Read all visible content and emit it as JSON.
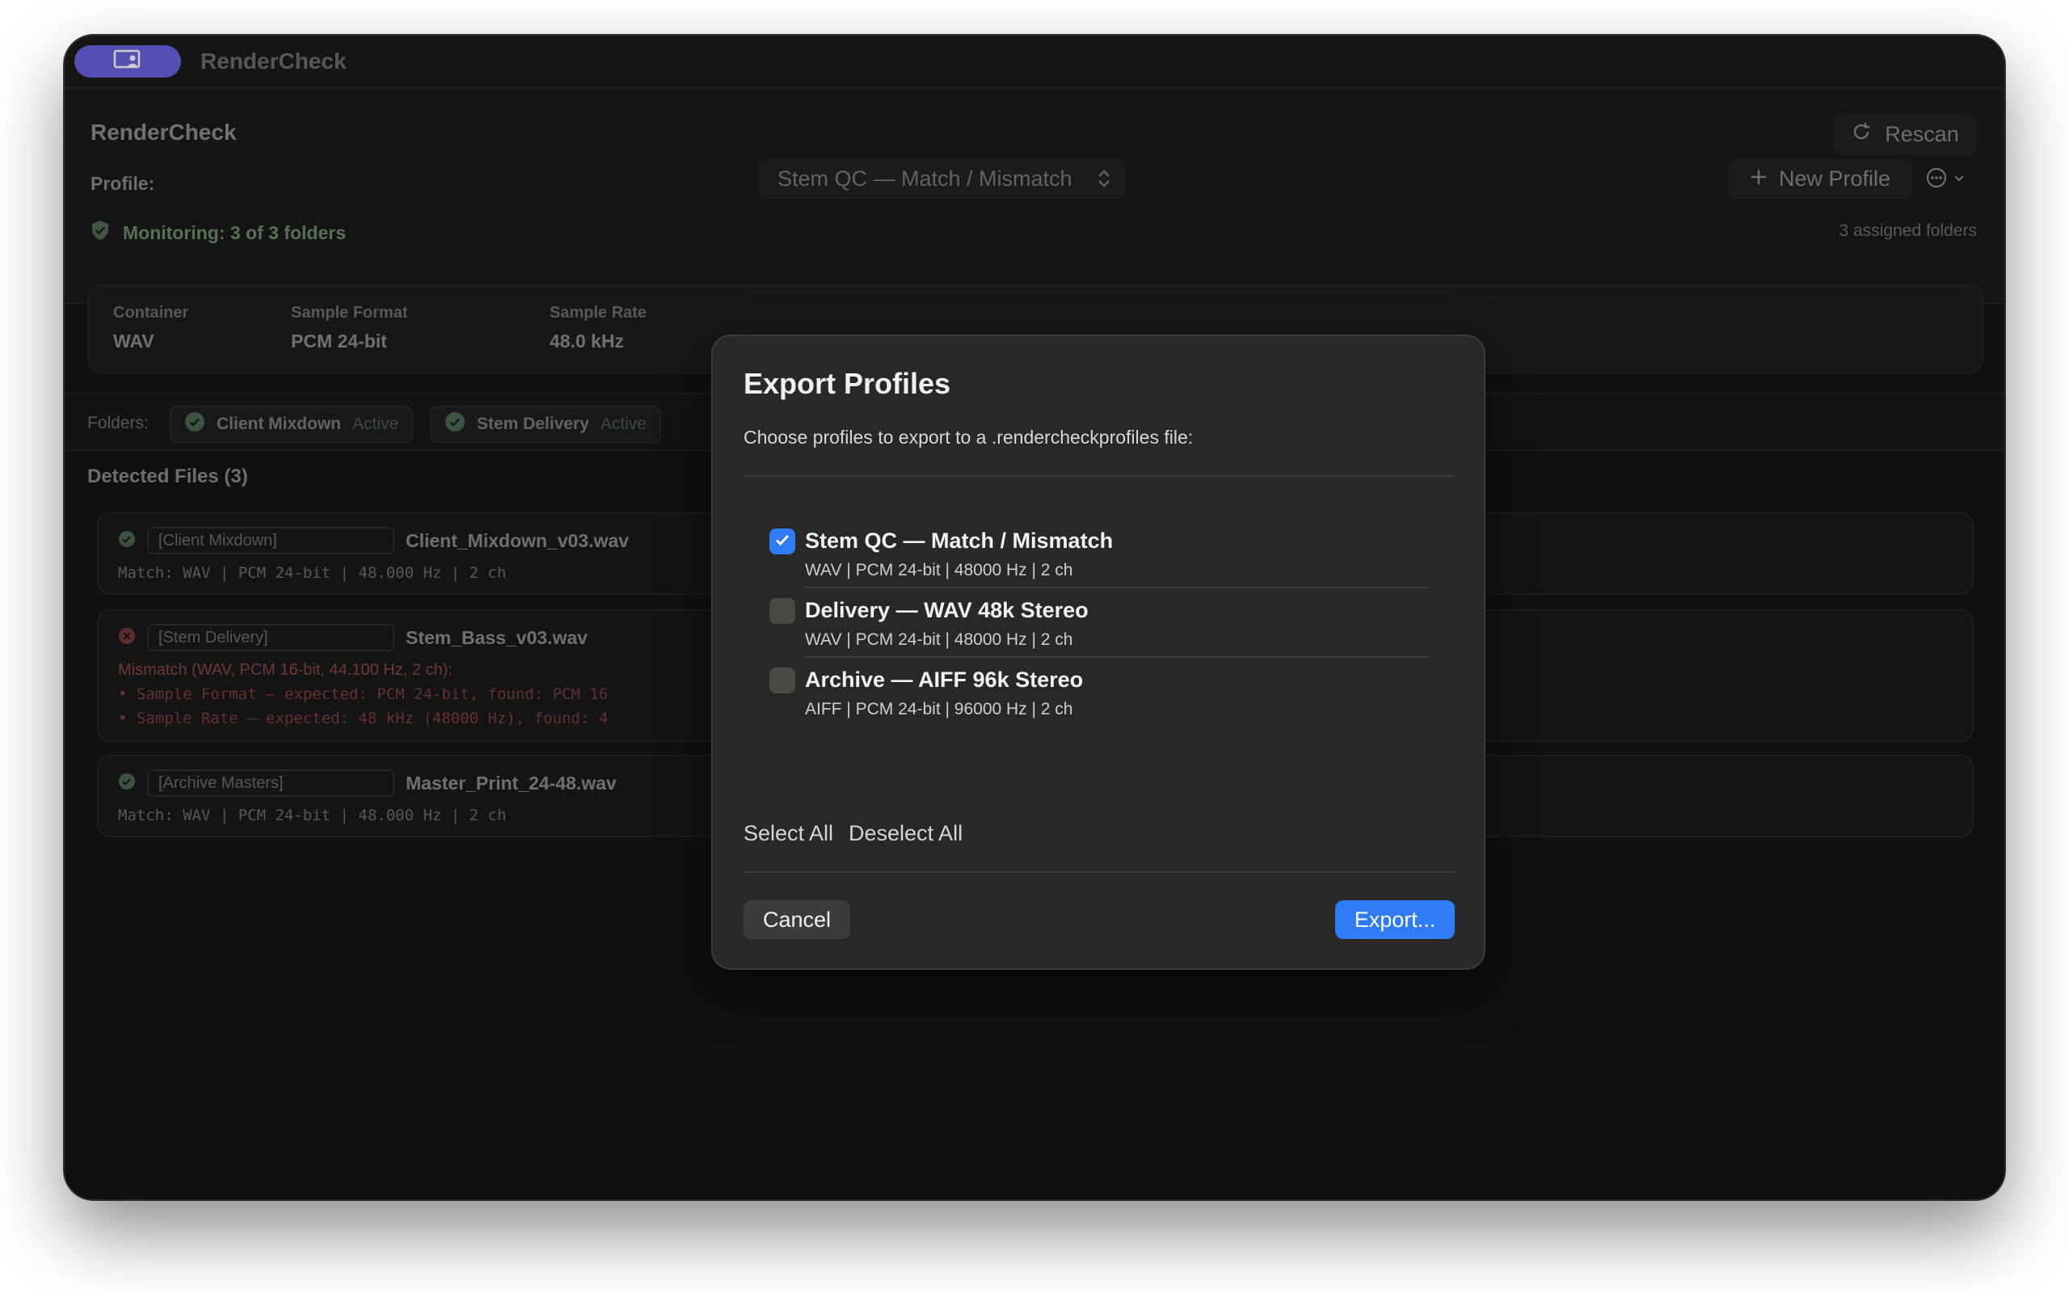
{
  "window": {
    "title": "RenderCheck",
    "app_icon": "person-in-window-icon"
  },
  "header": {
    "app_title": "RenderCheck",
    "rescan_label": "Rescan",
    "profile_label": "Profile:",
    "profile_selected": "Stem QC — Match / Mismatch",
    "new_profile_label": "New Profile",
    "monitoring_text": "Monitoring: 3 of 3 folders",
    "assigned_text": "3 assigned folders"
  },
  "summary": [
    {
      "key": "Container",
      "value": "WAV"
    },
    {
      "key": "Sample Format",
      "value": "PCM 24-bit"
    },
    {
      "key": "Sample Rate",
      "value": "48.0 kHz"
    }
  ],
  "folders": {
    "label": "Folders:",
    "chips": [
      {
        "name": "Client Mixdown",
        "state": "Active"
      },
      {
        "name": "Stem Delivery",
        "state": "Active"
      }
    ]
  },
  "detected": {
    "title": "Detected Files (3)",
    "files": [
      {
        "folder": "[Client Mixdown]",
        "name": "Client_Mixdown_v03.wav",
        "status": "match",
        "detail": "Match: WAV | PCM 24-bit | 48.000 Hz | 2 ch"
      },
      {
        "folder": "[Stem Delivery]",
        "name": "Stem_Bass_v03.wav",
        "status": "mismatch",
        "detail": "Mismatch (WAV, PCM 16-bit, 44.100 Hz, 2 ch):",
        "errors": [
          "• Sample Format — expected: PCM 24-bit, found: PCM 16",
          "• Sample Rate — expected: 48 kHz (48000 Hz), found: 4"
        ]
      },
      {
        "folder": "[Archive Masters]",
        "name": "Master_Print_24-48.wav",
        "status": "match",
        "detail": "Match: WAV | PCM 24-bit | 48.000 Hz | 2 ch"
      }
    ]
  },
  "modal": {
    "title": "Export Profiles",
    "subtitle": "Choose profiles to export to a .rendercheckprofiles file:",
    "profiles": [
      {
        "name": "Stem QC — Match / Mismatch",
        "meta": "WAV | PCM 24-bit | 48000 Hz | 2 ch",
        "checked": true
      },
      {
        "name": "Delivery — WAV 48k Stereo",
        "meta": "WAV | PCM 24-bit | 48000 Hz | 2 ch",
        "checked": false
      },
      {
        "name": "Archive — AIFF 96k Stereo",
        "meta": "AIFF | PCM 24-bit | 96000 Hz | 2 ch",
        "checked": false
      }
    ],
    "select_all": "Select All",
    "deselect_all": "Deselect All",
    "cancel": "Cancel",
    "export": "Export..."
  },
  "colors": {
    "accent": "#2f7cf6",
    "app_pill": "#6a63e0",
    "match": "#5f9b68",
    "mismatch": "#a34a4a"
  }
}
